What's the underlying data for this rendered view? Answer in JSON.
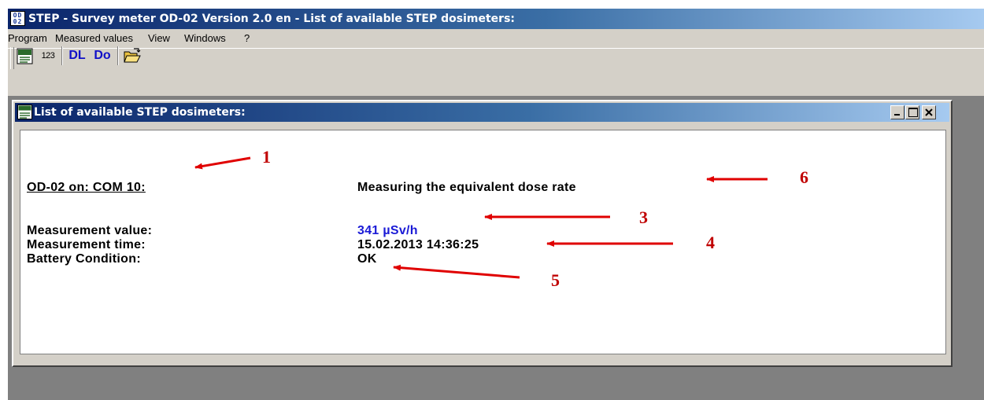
{
  "app": {
    "icon_text": "OD 02",
    "title": "STEP - Survey meter OD-02  Version 2.0 en - List of available STEP dosimeters:"
  },
  "menu": [
    "Program",
    "Measured values",
    "View",
    "Windows",
    "?"
  ],
  "toolbar": {
    "info_icon_text": "InF",
    "values_label": "123",
    "dl_label": "DL",
    "do_label": "Do"
  },
  "child_window": {
    "icon_text": "InF",
    "title": "List of available STEP dosimeters:",
    "minimize_glyph": "_",
    "maximize_glyph": "□",
    "close_glyph": "✕"
  },
  "device": {
    "port_label": "OD-02 on: COM 10:",
    "mode": "Measuring the equivalent dose rate",
    "measurement_value_label": "Measurement value:",
    "measurement_value": "341 µSv/h",
    "measurement_time_label": "Measurement time:",
    "measurement_time": "15.02.2013 14:36:25",
    "battery_label": "Battery Condition:",
    "battery_value": "OK"
  },
  "annotations": [
    "1",
    "3",
    "4",
    "5",
    "6"
  ],
  "colors": {
    "title_bar": "#0a246a",
    "face": "#d4d0c8",
    "mdi_background": "#808080",
    "value_blue": "#1a1ad6",
    "callout_red": "#c00000"
  }
}
